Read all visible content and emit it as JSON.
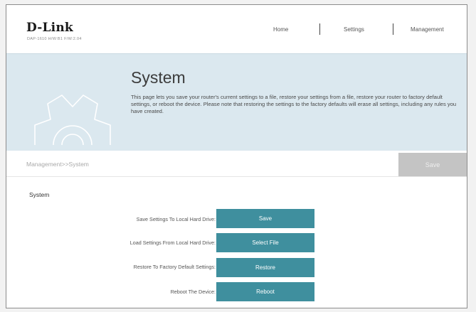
{
  "header": {
    "logo": "D-Link",
    "model": "DAP-1610 H/W:B1 F/W:2.04",
    "nav": [
      "Home",
      "Settings",
      "Management"
    ]
  },
  "banner": {
    "title": "System",
    "description": "This page lets you save your router's current settings to a file, restore your settings from a file, restore your router to factory default settings, or reboot the device. Please note that restoring the settings to the factory defaults will erase all settings, including any rules you have created."
  },
  "breadcrumb": "Management>>System",
  "top_save_label": "Save",
  "section": {
    "title": "System",
    "rows": [
      {
        "label": "Save Settings To Local Hard Drive:",
        "button": "Save"
      },
      {
        "label": "Load Settings From Local Hard Drive:",
        "button": "Select File"
      },
      {
        "label": "Restore To Factory Default Settings:",
        "button": "Restore"
      },
      {
        "label": "Reboot The Device:",
        "button": "Reboot"
      }
    ]
  },
  "colors": {
    "accent": "#3f8f9e",
    "banner_bg": "#dbe8ef",
    "disabled_button": "#c4c4c4"
  },
  "icons": {
    "banner": "gear-icon"
  }
}
